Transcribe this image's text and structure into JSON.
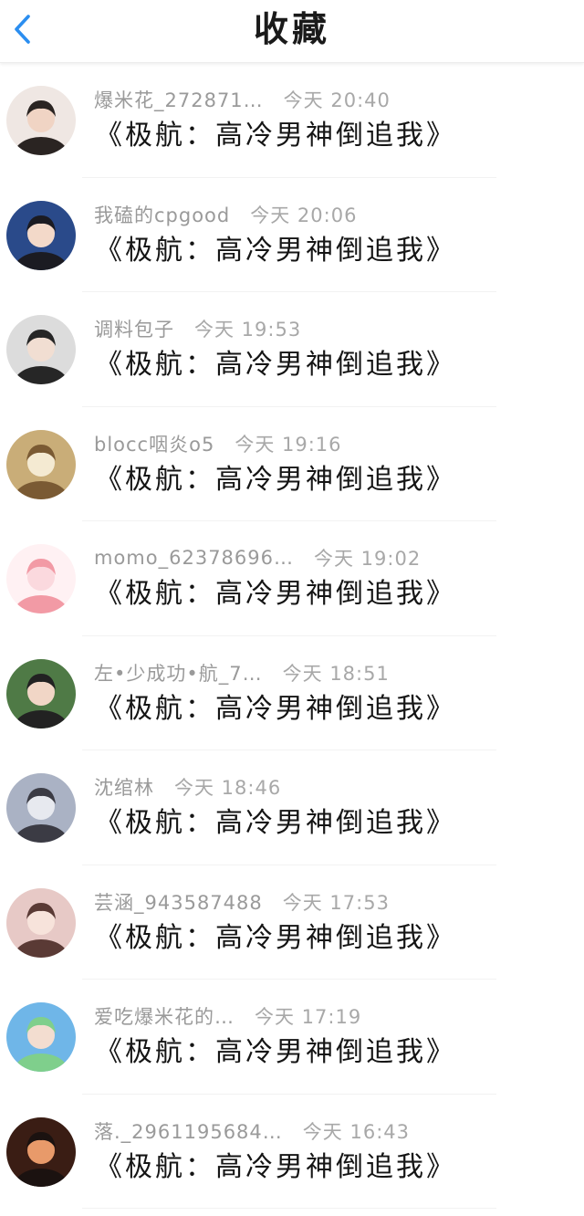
{
  "header": {
    "title": "收藏",
    "back_icon": "chevron-left-icon"
  },
  "colors": {
    "accent": "#2b8ef0",
    "meta_text": "#9a9a9a",
    "title_text": "#151515"
  },
  "items": [
    {
      "username": "爆米花_272871…",
      "time": "今天 20:40",
      "book": "《极航：高冷男神倒追我》",
      "avatar_colors": [
        "#efe7e3",
        "#2a2422",
        "#f0d4c4"
      ]
    },
    {
      "username": "我磕的cpgood",
      "time": "今天 20:06",
      "book": "《极航：高冷男神倒追我》",
      "avatar_colors": [
        "#2a4a8a",
        "#1b1b22",
        "#f3d9c9"
      ]
    },
    {
      "username": "调料包子",
      "time": "今天 19:53",
      "book": "《极航：高冷男神倒追我》",
      "avatar_colors": [
        "#dcdcdc",
        "#262626",
        "#f1ded2"
      ]
    },
    {
      "username": "blocc咽炎o5",
      "time": "今天 19:16",
      "book": "《极航：高冷男神倒追我》",
      "avatar_colors": [
        "#c9ad78",
        "#7a5a33",
        "#f4ead2"
      ]
    },
    {
      "username": "momo_62378696…",
      "time": "今天 19:02",
      "book": "《极航：高冷男神倒追我》",
      "avatar_colors": [
        "#fff1f3",
        "#f29aa5",
        "#fbd9de"
      ]
    },
    {
      "username": "左•少成功•航_7…",
      "time": "今天 18:51",
      "book": "《极航：高冷男神倒追我》",
      "avatar_colors": [
        "#4f7a46",
        "#222222",
        "#f1d6c6"
      ]
    },
    {
      "username": "沈绾林",
      "time": "今天 18:46",
      "book": "《极航：高冷男神倒追我》",
      "avatar_colors": [
        "#aab2c4",
        "#3b3b44",
        "#e7e9ef"
      ]
    },
    {
      "username": "芸涵_943587488",
      "time": "今天 17:53",
      "book": "《极航：高冷男神倒追我》",
      "avatar_colors": [
        "#e7c9c6",
        "#5a3a35",
        "#f7e3db"
      ]
    },
    {
      "username": "爱吃爆米花的…",
      "time": "今天 17:19",
      "book": "《极航：高冷男神倒追我》",
      "avatar_colors": [
        "#6fb6e8",
        "#7fcf8c",
        "#f3ddd0"
      ]
    },
    {
      "username": "落._2961195684…",
      "time": "今天 16:43",
      "book": "《极航：高冷男神倒追我》",
      "avatar_colors": [
        "#3a1d14",
        "#1b1210",
        "#e89a6a"
      ]
    }
  ]
}
